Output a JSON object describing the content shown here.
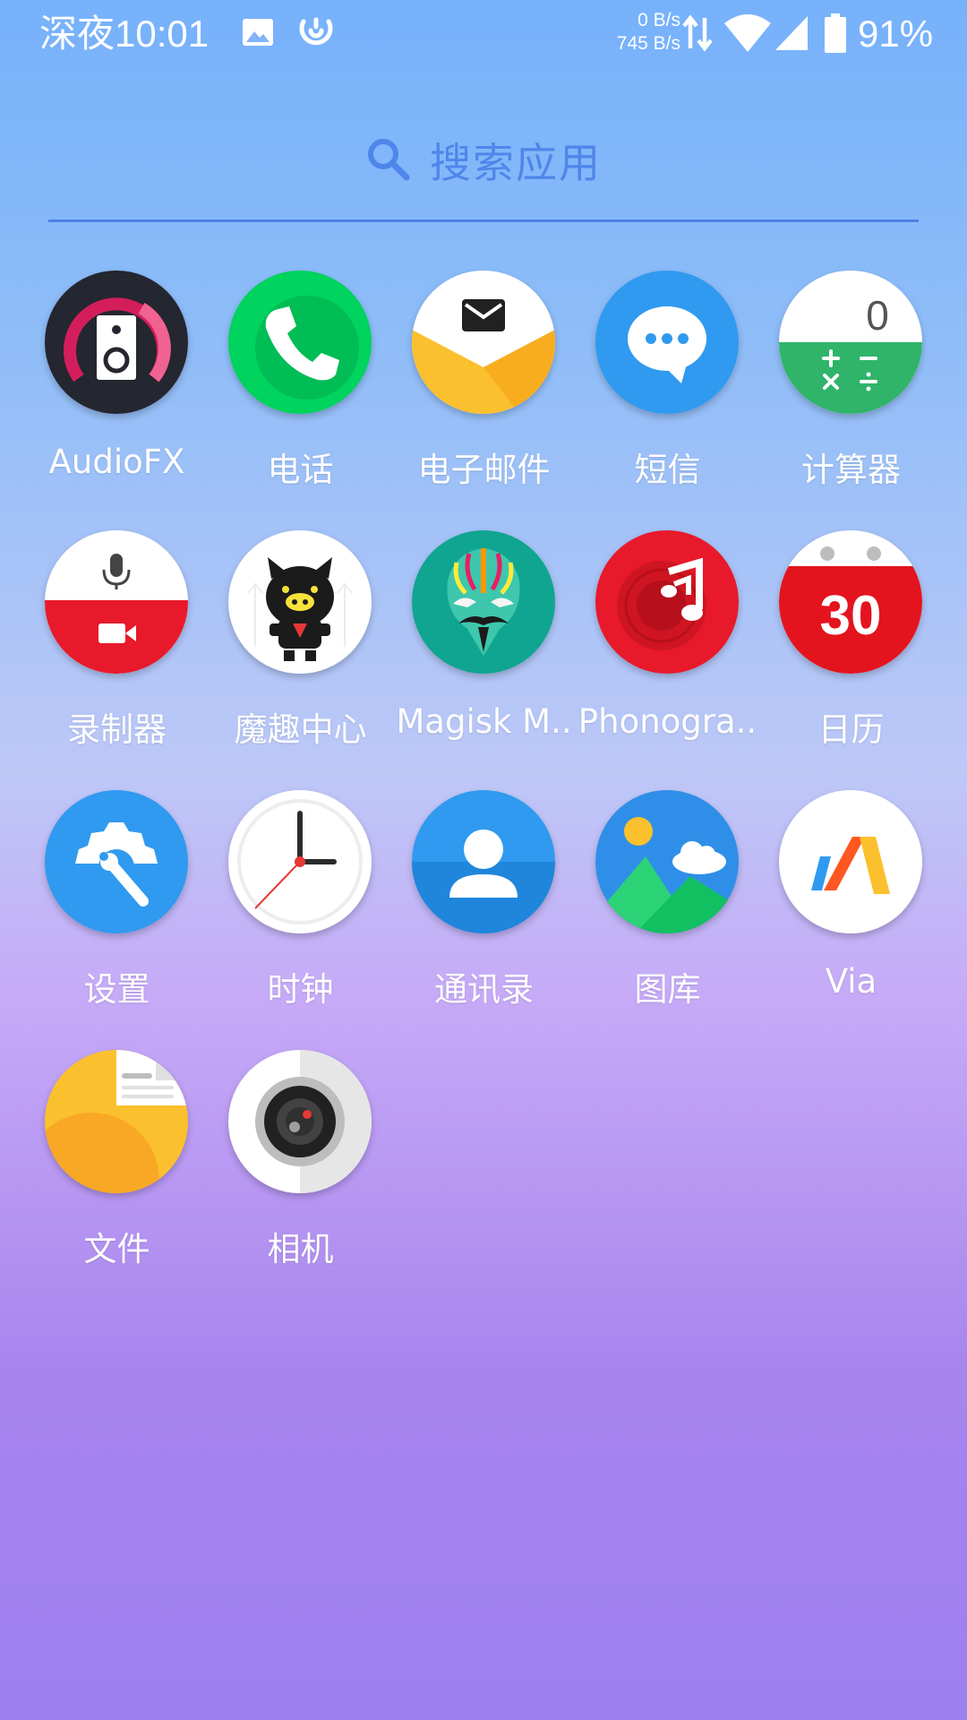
{
  "status_bar": {
    "time": "深夜10:01",
    "net_up": "0 B/s",
    "net_down": "745 B/s",
    "battery": "91%"
  },
  "search": {
    "placeholder": "搜索应用"
  },
  "apps": [
    {
      "label": "AudioFX",
      "icon": "audiofx-icon"
    },
    {
      "label": "电话",
      "icon": "phone-icon"
    },
    {
      "label": "电子邮件",
      "icon": "email-icon"
    },
    {
      "label": "短信",
      "icon": "messaging-icon"
    },
    {
      "label": "计算器",
      "icon": "calculator-icon"
    },
    {
      "label": "录制器",
      "icon": "recorder-icon"
    },
    {
      "label": "魔趣中心",
      "icon": "mokee-center-icon"
    },
    {
      "label": "Magisk M..",
      "icon": "magisk-manager-icon"
    },
    {
      "label": "Phonogra..",
      "icon": "phonograph-icon"
    },
    {
      "label": "日历",
      "icon": "calendar-icon"
    },
    {
      "label": "设置",
      "icon": "settings-icon"
    },
    {
      "label": "时钟",
      "icon": "clock-icon"
    },
    {
      "label": "通讯录",
      "icon": "contacts-icon"
    },
    {
      "label": "图库",
      "icon": "gallery-icon"
    },
    {
      "label": "Via",
      "icon": "via-browser-icon"
    },
    {
      "label": "文件",
      "icon": "files-icon"
    },
    {
      "label": "相机",
      "icon": "camera-icon"
    }
  ],
  "calendar_day": "30",
  "calculator_display": "0",
  "colors": {
    "search_accent": "#4f86ea",
    "phone_green": "#00d35e",
    "messaging_blue": "#2f9aef",
    "calendar_red": "#e3141e"
  }
}
